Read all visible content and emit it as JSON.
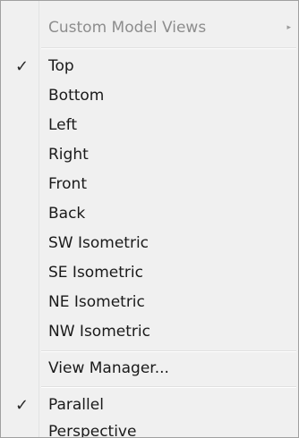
{
  "menu": {
    "submenu_header": {
      "label": "Custom Model Views",
      "arrow": "▸"
    },
    "check_glyph": "✓",
    "views": [
      {
        "label": "Top",
        "checked": true
      },
      {
        "label": "Bottom",
        "checked": false
      },
      {
        "label": "Left",
        "checked": false
      },
      {
        "label": "Right",
        "checked": false
      },
      {
        "label": "Front",
        "checked": false
      },
      {
        "label": "Back",
        "checked": false
      },
      {
        "label": "SW Isometric",
        "checked": false
      },
      {
        "label": "SE Isometric",
        "checked": false
      },
      {
        "label": "NE Isometric",
        "checked": false
      },
      {
        "label": "NW Isometric",
        "checked": false
      }
    ],
    "view_manager": {
      "label": "View Manager..."
    },
    "projection": [
      {
        "label": "Parallel",
        "checked": true
      },
      {
        "label": "Perspective",
        "checked": false
      }
    ]
  }
}
